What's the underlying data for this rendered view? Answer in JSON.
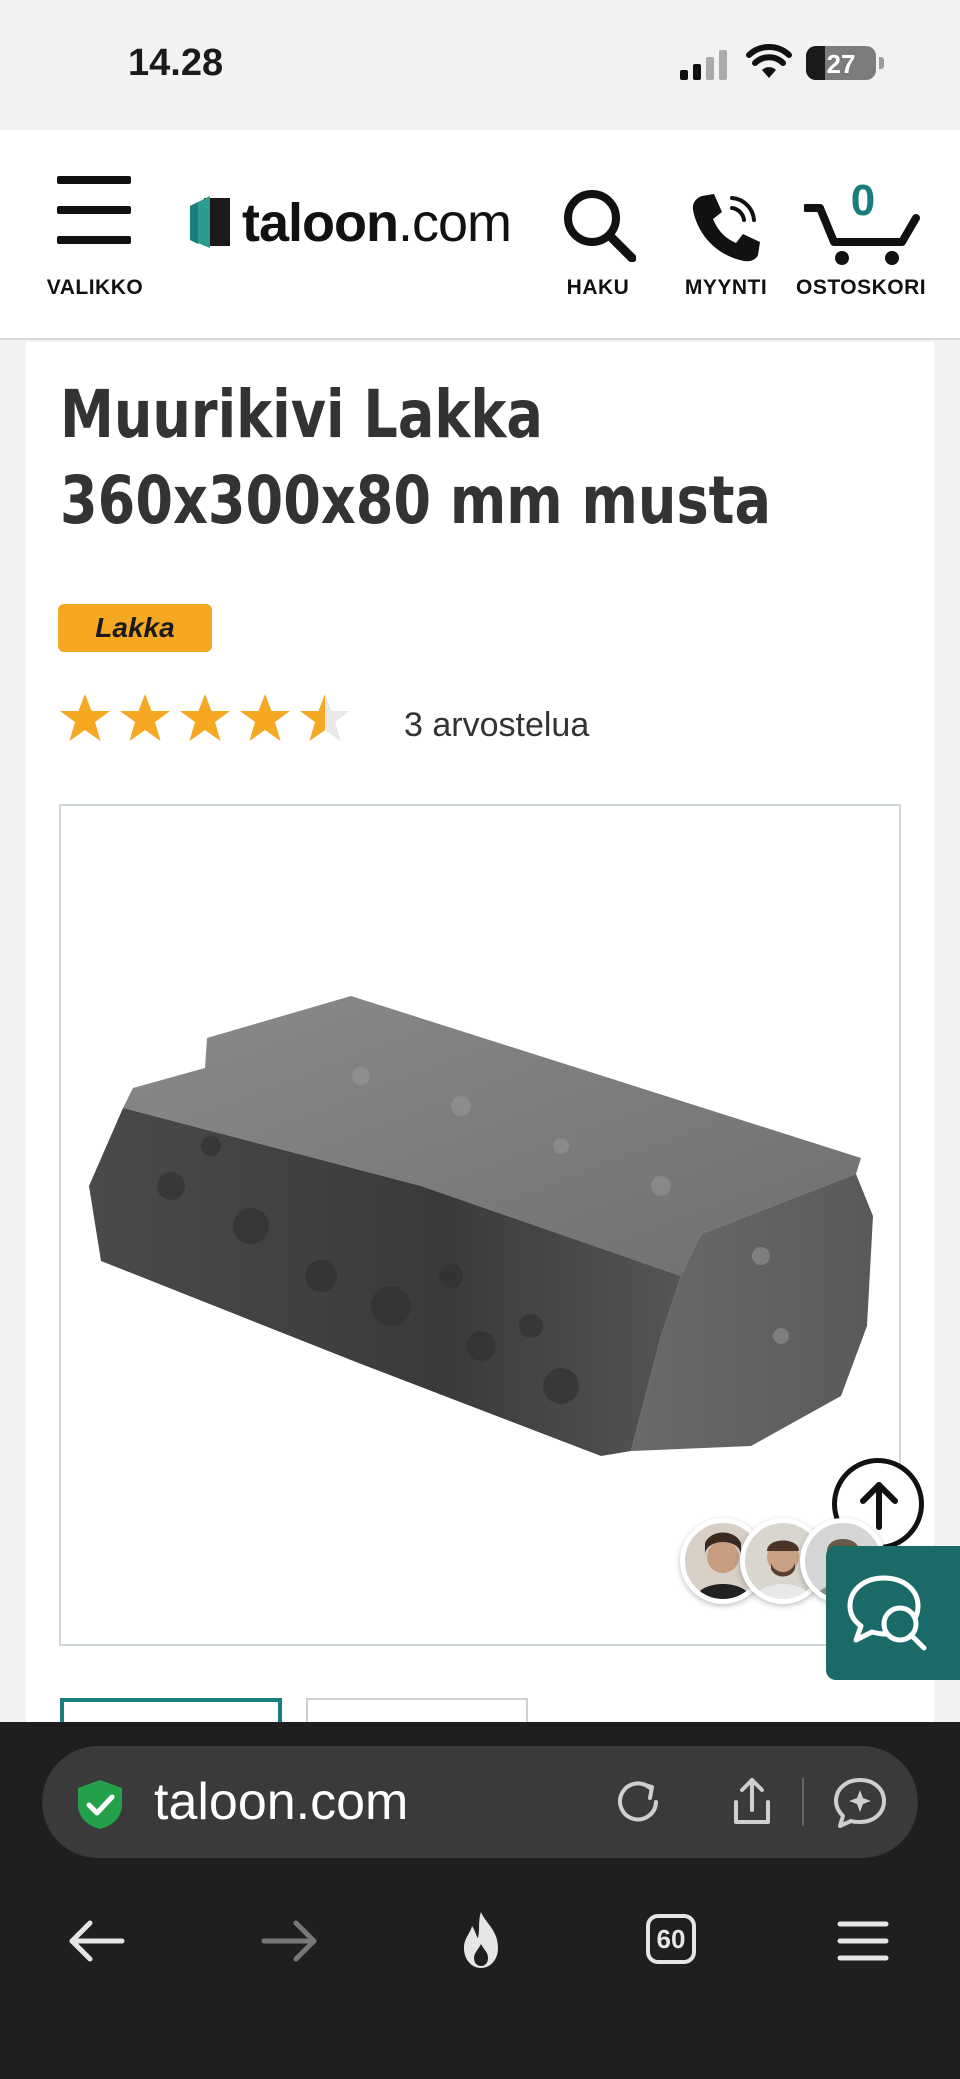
{
  "status_bar": {
    "time": "14.28",
    "battery": "27",
    "battery_level": 0.27
  },
  "header": {
    "menu_label": "VALIKKO",
    "logo_text_main": "taloon",
    "logo_text_suffix": ".com",
    "search_label": "HAKU",
    "sales_label": "MYYNTI",
    "cart_label": "OSTOSKORI",
    "cart_count": "0",
    "accent_color": "#1a7d7d"
  },
  "product": {
    "title": "Muurikivi Lakka 360x300x80 mm musta",
    "brand": "Lakka",
    "brand_color": "#f7a823",
    "rating": 4.5,
    "rating_max": 5,
    "review_text": "3 arvostelua",
    "star_color": "#f7a823"
  },
  "browser": {
    "url": "taloon.com",
    "tab_count": "60",
    "icons": [
      "secure-shield-icon",
      "reload-icon",
      "share-icon",
      "assistant-icon",
      "back-icon",
      "forward-icon",
      "flame-icon",
      "tabs-icon",
      "menu-icon"
    ]
  },
  "floating": {
    "chat_color": "#1a6b68",
    "icons": [
      "scroll-top-icon",
      "chat-icon"
    ]
  }
}
